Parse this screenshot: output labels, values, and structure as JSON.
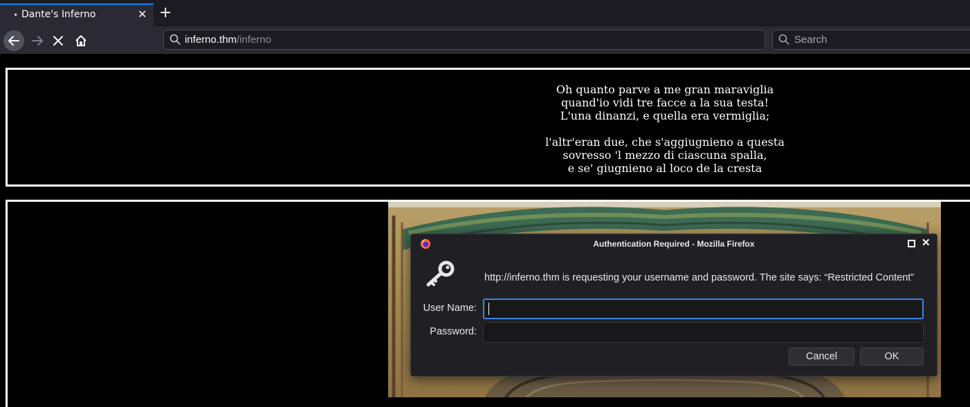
{
  "browser": {
    "tab": {
      "dot": "•",
      "title": "Dante's Inferno",
      "close": "✕"
    },
    "new_tab_symbol": "+",
    "urlbar": {
      "host": "inferno.thm",
      "path": "/inferno"
    },
    "searchbar": {
      "placeholder": "Search"
    }
  },
  "page": {
    "poem": {
      "stanza1": [
        "Oh quanto parve a me gran maraviglia",
        "quand'io vidi tre facce a la sua testa!",
        "L'una dinanzi, e quella era vermiglia;"
      ],
      "stanza2": [
        "l'altr'eran due, che s'aggiugnieno a questa",
        "sovresso 'l mezzo di ciascuna spalla,",
        "e se' giugnieno al loco de la cresta"
      ]
    }
  },
  "dialog": {
    "title": "Authentication Required - Mozilla Firefox",
    "message": "http://inferno.thm is requesting your username and password. The site says: “Restricted Content”",
    "username_label": "User Name:",
    "password_label": "Password:",
    "username_value": "",
    "password_value": "",
    "cancel_label": "Cancel",
    "ok_label": "OK",
    "close_symbol": "✕"
  },
  "colors": {
    "accent": "#0a84ff",
    "focus": "#3d85e0"
  }
}
